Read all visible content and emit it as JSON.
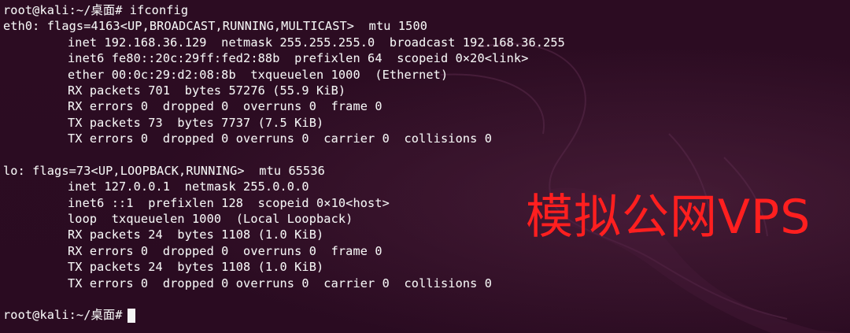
{
  "terminal": {
    "colors": {
      "background": "#2b0d21",
      "text": "#f2f2f2",
      "watermark": "#ff1f1f"
    },
    "first_prompt": "root@kali:~/桌面# ifconfig",
    "eth0": {
      "header": "eth0: flags=4163<UP,BROADCAST,RUNNING,MULTICAST>  mtu 1500",
      "lines": [
        "inet 192.168.36.129  netmask 255.255.255.0  broadcast 192.168.36.255",
        "inet6 fe80::20c:29ff:fed2:88b  prefixlen 64  scopeid 0×20<link>",
        "ether 00:0c:29:d2:08:8b  txqueuelen 1000  (Ethernet)",
        "RX packets 701  bytes 57276 (55.9 KiB)",
        "RX errors 0  dropped 0  overruns 0  frame 0",
        "TX packets 73  bytes 7737 (7.5 KiB)",
        "TX errors 0  dropped 0 overruns 0  carrier 0  collisions 0"
      ]
    },
    "lo": {
      "header": "lo: flags=73<UP,LOOPBACK,RUNNING>  mtu 65536",
      "lines": [
        "inet 127.0.0.1  netmask 255.0.0.0",
        "inet6 ::1  prefixlen 128  scopeid 0×10<host>",
        "loop  txqueuelen 1000  (Local Loopback)",
        "RX packets 24  bytes 1108 (1.0 KiB)",
        "RX errors 0  dropped 0  overruns 0  frame 0",
        "TX packets 24  bytes 1108 (1.0 KiB)",
        "TX errors 0  dropped 0 overruns 0  carrier 0  collisions 0"
      ]
    },
    "final_prompt": "root@kali:~/桌面#",
    "watermark": "模拟公网VPS"
  }
}
